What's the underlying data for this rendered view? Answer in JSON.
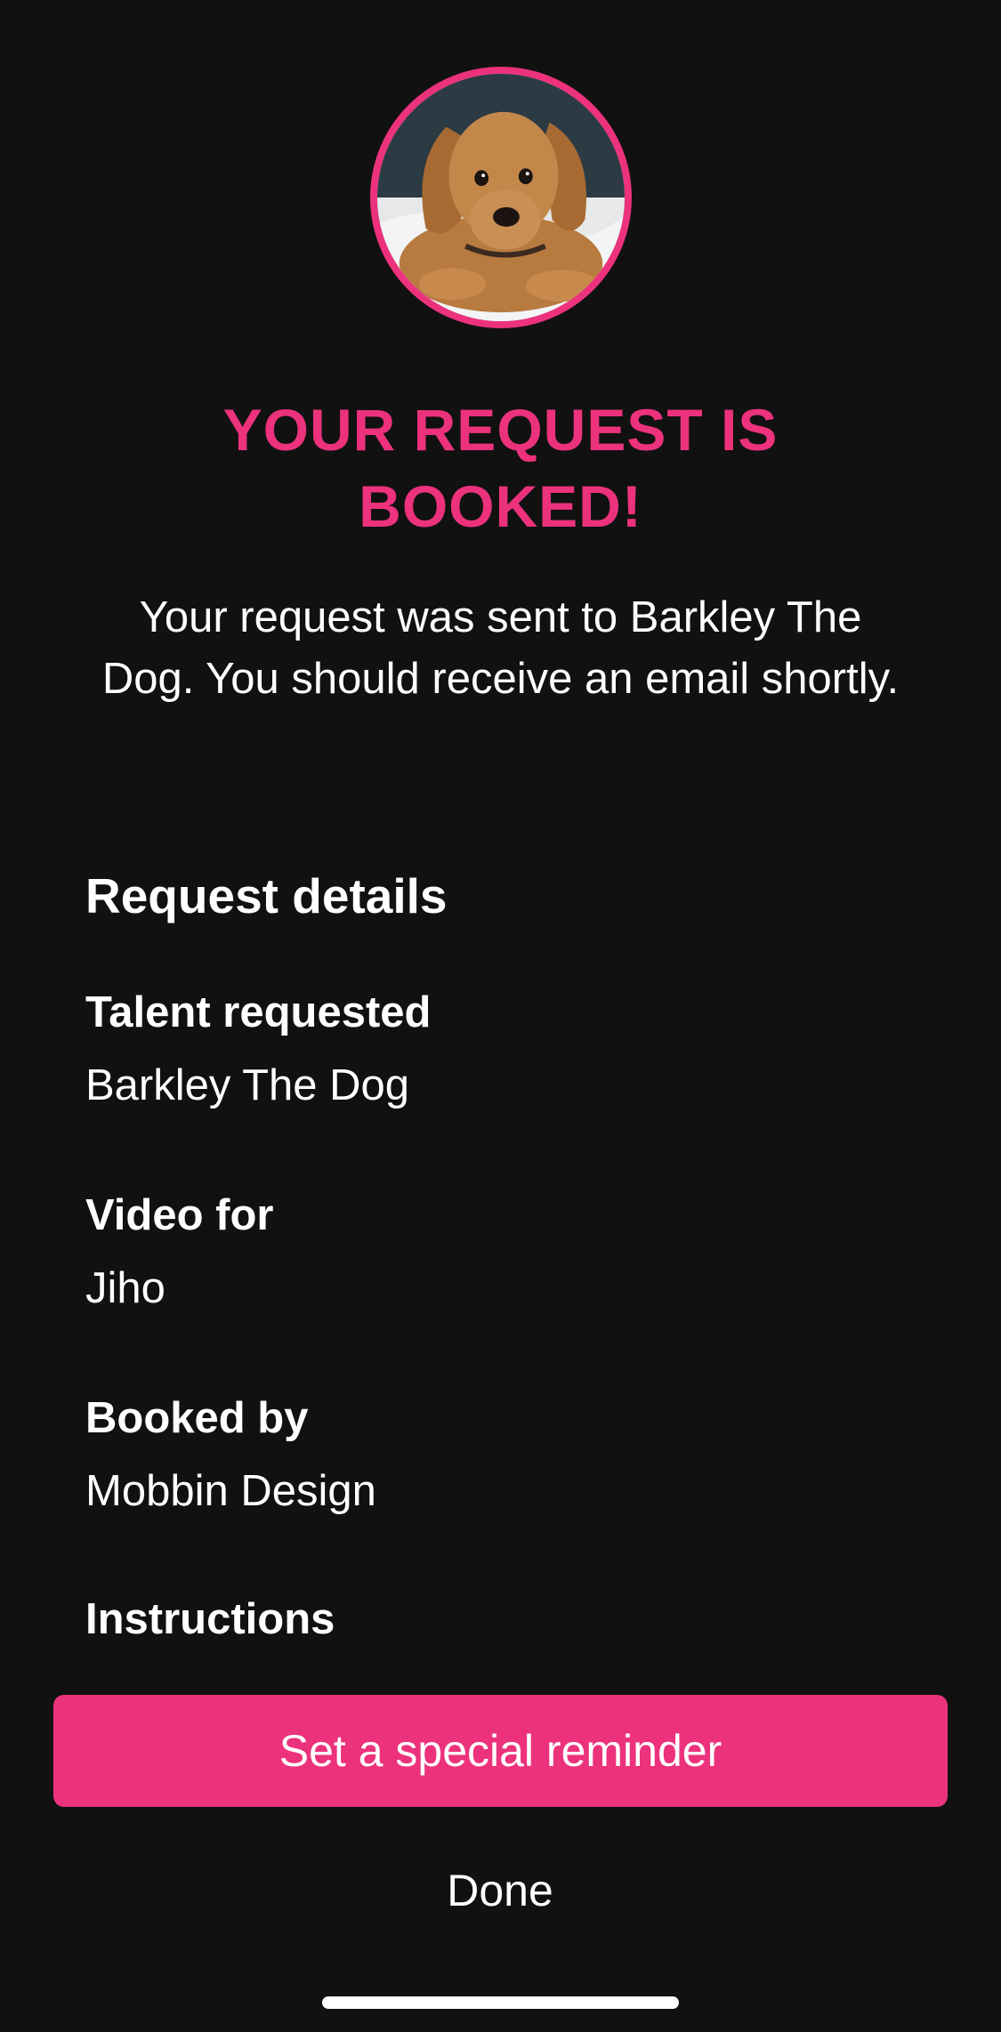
{
  "header": {
    "avatar_icon": "dog-photo",
    "title": "YOUR REQUEST IS BOOKED!",
    "message": "Your request was sent to Barkley The Dog. You should receive an email shortly."
  },
  "details": {
    "section_title": "Request details",
    "items": [
      {
        "label": "Talent requested",
        "value": "Barkley The Dog"
      },
      {
        "label": "Video for",
        "value": "Jiho"
      },
      {
        "label": "Booked by",
        "value": "Mobbin Design"
      },
      {
        "label": "Instructions",
        "value": ""
      }
    ]
  },
  "actions": {
    "reminder_label": "Set a special reminder",
    "done_label": "Done"
  },
  "colors": {
    "accent": "#ec327c",
    "background": "#111111",
    "text": "#ffffff"
  }
}
